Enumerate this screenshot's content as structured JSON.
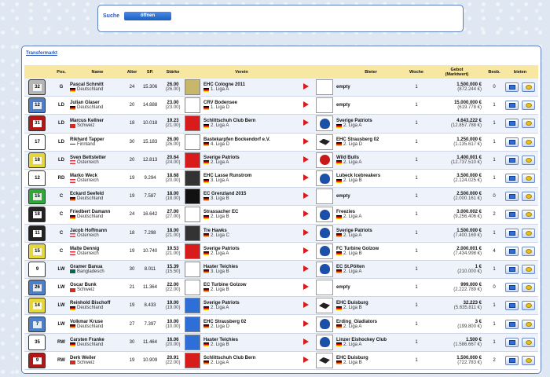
{
  "search": {
    "label": "Suche",
    "button": "öffnen"
  },
  "market": {
    "title": "Transfermarkt",
    "headers": {
      "pos": "Pos.",
      "name": "Name",
      "age": "Alter",
      "sp": "SP.",
      "strength": "Stärke",
      "club": "Verein",
      "bidder": "Bieter",
      "week": "Woche",
      "bid_line1": "Gebot",
      "bid_line2": "(Marktwert)",
      "bids": "Beob.",
      "actions": "bieten"
    },
    "colors": {
      "header_bg": "#f7e7a0",
      "accent": "#2a57b7",
      "arrow": "#d81b1b"
    },
    "rows": [
      {
        "jersey_color": "#b5b5b5",
        "jersey_num": "32",
        "pos": "G",
        "name": "Pascal Schmitt",
        "country": "Deutschland",
        "flag": "de",
        "age": "24",
        "sp": "15.306",
        "strength": "26.00",
        "strength_sub": "(26.00)",
        "club": "EHC Cologne 2011",
        "league": "1. Liga A",
        "club_logo": "#c8b66a",
        "bidder": "empty",
        "bidder_league": "",
        "bidder_logo": "none",
        "week": "1",
        "bid": "1.500.000 €",
        "market_value": "(872.244 €)",
        "bids": "0"
      },
      {
        "jersey_color": "#4d7fc9",
        "jersey_num": "12",
        "pos": "LD",
        "name": "Julian Glaser",
        "country": "Deutschland",
        "flag": "de",
        "age": "20",
        "sp": "14.888",
        "strength": "23.00",
        "strength_sub": "(23.00)",
        "club": "CRV Bodensee",
        "league": "1. Liga D",
        "club_logo": "#ffffff",
        "bidder": "empty",
        "bidder_league": "",
        "bidder_logo": "none",
        "week": "1",
        "bid": "15.000.000 €",
        "market_value": "(619.778 €)",
        "bids": "1"
      },
      {
        "jersey_color": "#b01818",
        "jersey_num": "31",
        "pos": "LD",
        "name": "Marcus Kellner",
        "country": "Schweiz",
        "flag": "ch",
        "age": "18",
        "sp": "10.018",
        "strength": "19.23",
        "strength_sub": "(21.00)",
        "club": "Schlittschuh Club Bern",
        "league": "2. Liga A",
        "club_logo": "#d81b1b",
        "bidder": "Sverige Patriots",
        "bidder_league": "2. Liga A",
        "bidder_logo": "blue",
        "week": "1",
        "bid": "4.643.222 €",
        "market_value": "(12.857.788 €)",
        "bids": "1"
      },
      {
        "jersey_color": "#ffffff",
        "jersey_num": "17",
        "pos": "LD",
        "name": "Rikhard Tapper",
        "country": "Finnland",
        "flag": "fi",
        "age": "30",
        "sp": "15.183",
        "strength": "26.00",
        "strength_sub": "(26.00)",
        "club": "Bastekarpfen Bockendorf e.V.",
        "league": "4. Liga D",
        "club_logo": "#ffffff",
        "bidder": "EHC Strausberg 02",
        "bidder_league": "2. Liga D",
        "bidder_logo": "dark",
        "week": "1",
        "bid": "1.250.000 €",
        "market_value": "(1.135.617 €)",
        "bids": "1"
      },
      {
        "jersey_color": "#e5d63a",
        "jersey_num": "18",
        "pos": "LD",
        "name": "Sven Bettstetter",
        "country": "Österreich",
        "flag": "at",
        "age": "20",
        "sp": "12.813",
        "strength": "20.64",
        "strength_sub": "(24.00)",
        "club": "Sverige Patriots",
        "league": "2. Liga A",
        "club_logo": "#d81b1b",
        "bidder": "Wild Bulls",
        "bidder_league": "2. Liga A",
        "bidder_logo": "red",
        "week": "1",
        "bid": "1.400.001 €",
        "market_value": "(12.737.510 €)",
        "bids": "1"
      },
      {
        "jersey_color": "#ffffff",
        "jersey_num": "12",
        "pos": "RD",
        "name": "Marko Weck",
        "country": "Österreich",
        "flag": "at",
        "age": "19",
        "sp": "9.294",
        "strength": "18.68",
        "strength_sub": "(20.00)",
        "club": "EHC Lasse Runstrom",
        "league": "3. Liga A",
        "club_logo": "#333333",
        "bidder": "Lubeck Icebreakers",
        "bidder_league": "2. Liga B",
        "bidder_logo": "blue",
        "week": "1",
        "bid": "3.500.000 €",
        "market_value": "(2.124.025 €)",
        "bids": "1"
      },
      {
        "jersey_color": "#2fa83a",
        "jersey_num": "15",
        "pos": "C",
        "name": "Eckard Seefeld",
        "country": "Deutschland",
        "flag": "de",
        "age": "19",
        "sp": "7.587",
        "strength": "18.00",
        "strength_sub": "(18.00)",
        "club": "EC Grenzland 2015",
        "league": "3. Liga B",
        "club_logo": "#111111",
        "bidder": "empty",
        "bidder_league": "",
        "bidder_logo": "none",
        "week": "1",
        "bid": "2.500.000 €",
        "market_value": "(2.000.161 €)",
        "bids": "0"
      },
      {
        "jersey_color": "#222222",
        "jersey_num": "18",
        "pos": "C",
        "name": "Friedbert Damann",
        "country": "Deutschland",
        "flag": "de",
        "age": "24",
        "sp": "16.642",
        "strength": "27.00",
        "strength_sub": "(27.00)",
        "club": "Strassacher EC",
        "league": "2. Liga B",
        "club_logo": "#ffffff",
        "bidder": "Freezies",
        "bidder_league": "2. Liga A",
        "bidder_logo": "blue",
        "week": "1",
        "bid": "3.000.002 €",
        "market_value": "(9.256.406 €)",
        "bids": "2"
      },
      {
        "jersey_color": "#222222",
        "jersey_num": "11",
        "pos": "C",
        "name": "Jacob Hoffmann",
        "country": "Österreich",
        "flag": "at",
        "age": "18",
        "sp": "7.298",
        "strength": "18.00",
        "strength_sub": "(21.00)",
        "club": "Tre Hawks",
        "league": "2. Liga C",
        "club_logo": "#333333",
        "bidder": "Sverige Patriots",
        "bidder_league": "2. Liga A",
        "bidder_logo": "blue",
        "week": "1",
        "bid": "1.500.000 €",
        "market_value": "(7.400.169 €)",
        "bids": "1"
      },
      {
        "jersey_color": "#e5d63a",
        "jersey_num": "15",
        "pos": "C",
        "name": "Malte Dennig",
        "country": "Österreich",
        "flag": "at",
        "age": "19",
        "sp": "10.740",
        "strength": "19.53",
        "strength_sub": "(21.00)",
        "club": "Sverige Patriots",
        "league": "2. Liga A",
        "club_logo": "#d81b1b",
        "bidder": "FC Turbine Golzow",
        "bidder_league": "2. Liga B",
        "bidder_logo": "blue",
        "week": "1",
        "bid": "2.000.001 €",
        "market_value": "(7.434.998 €)",
        "bids": "4"
      },
      {
        "jersey_color": "#ffffff",
        "jersey_num": "9",
        "pos": "LW",
        "name": "Gramer Banua",
        "country": "Bangladesch",
        "flag": "bd",
        "age": "30",
        "sp": "8.011",
        "strength": "15.39",
        "strength_sub": "(15.50)",
        "club": "Haster Teichies",
        "league": "3. Liga B",
        "club_logo": "#ffffff",
        "bidder": "EC St.Pölten",
        "bidder_league": "2. Liga A",
        "bidder_logo": "blue",
        "week": "1",
        "bid": "1 €",
        "market_value": "(210.000 €)",
        "bids": "1"
      },
      {
        "jersey_color": "#4d7fc9",
        "jersey_num": "26",
        "pos": "LW",
        "name": "Oscar Bunk",
        "country": "Schweiz",
        "flag": "ch",
        "age": "21",
        "sp": "11.364",
        "strength": "22.00",
        "strength_sub": "(22.00)",
        "club": "EC Turbine Golzow",
        "league": "2. Liga B",
        "club_logo": "#ffffff",
        "bidder": "empty",
        "bidder_league": "",
        "bidder_logo": "none",
        "week": "1",
        "bid": "999.000 €",
        "market_value": "(2.222.789 €)",
        "bids": "0"
      },
      {
        "jersey_color": "#e5d63a",
        "jersey_num": "14",
        "pos": "LW",
        "name": "Reinhold Bischoff",
        "country": "Deutschland",
        "flag": "de",
        "age": "19",
        "sp": "8.433",
        "strength": "19.00",
        "strength_sub": "(19.00)",
        "club": "Sverige Patriots",
        "league": "2. Liga A",
        "club_logo": "#2d6fd6",
        "bidder": "EHC Duisburg",
        "bidder_league": "2. Liga B",
        "bidder_logo": "dark",
        "week": "1",
        "bid": "32.223 €",
        "market_value": "(5.635.811 €)",
        "bids": "1"
      },
      {
        "jersey_color": "#4d7fc9",
        "jersey_num": "7",
        "pos": "LW",
        "name": "Volkmar Kruse",
        "country": "Deutschland",
        "flag": "de",
        "age": "27",
        "sp": "7.397",
        "strength": "10.00",
        "strength_sub": "(10.00)",
        "club": "EHC Strausberg 02",
        "league": "2. Liga D",
        "club_logo": "#2d6fd6",
        "bidder": "Erding_Gladiators",
        "bidder_league": "2. Liga A",
        "bidder_logo": "blue",
        "week": "1",
        "bid": "3 €",
        "market_value": "(199.800 €)",
        "bids": "1"
      },
      {
        "jersey_color": "#ffffff",
        "jersey_num": "35",
        "pos": "RW",
        "name": "Carsten Franke",
        "country": "Deutschland",
        "flag": "de",
        "age": "30",
        "sp": "11.464",
        "strength": "16.06",
        "strength_sub": "(20.00)",
        "club": "Haster Teichies",
        "league": "2. Liga B",
        "club_logo": "#2d6fd6",
        "bidder": "Linzer Eishockey Club",
        "bidder_league": "2. Liga A",
        "bidder_logo": "blue",
        "week": "1",
        "bid": "1.500 €",
        "market_value": "(1.586.667 €)",
        "bids": "1"
      },
      {
        "jersey_color": "#b01818",
        "jersey_num": "9",
        "pos": "RW",
        "name": "Derk Weiler",
        "country": "Schweiz",
        "flag": "ch",
        "age": "19",
        "sp": "10.909",
        "strength": "20.91",
        "strength_sub": "(22.00)",
        "club": "Schlittschuh Club Bern",
        "league": "2. Liga A",
        "club_logo": "#d81b1b",
        "bidder": "EHC Duisburg",
        "bidder_league": "2. Liga B",
        "bidder_logo": "dark",
        "week": "1",
        "bid": "1.500.000 €",
        "market_value": "(722.783 €)",
        "bids": "2"
      }
    ]
  }
}
